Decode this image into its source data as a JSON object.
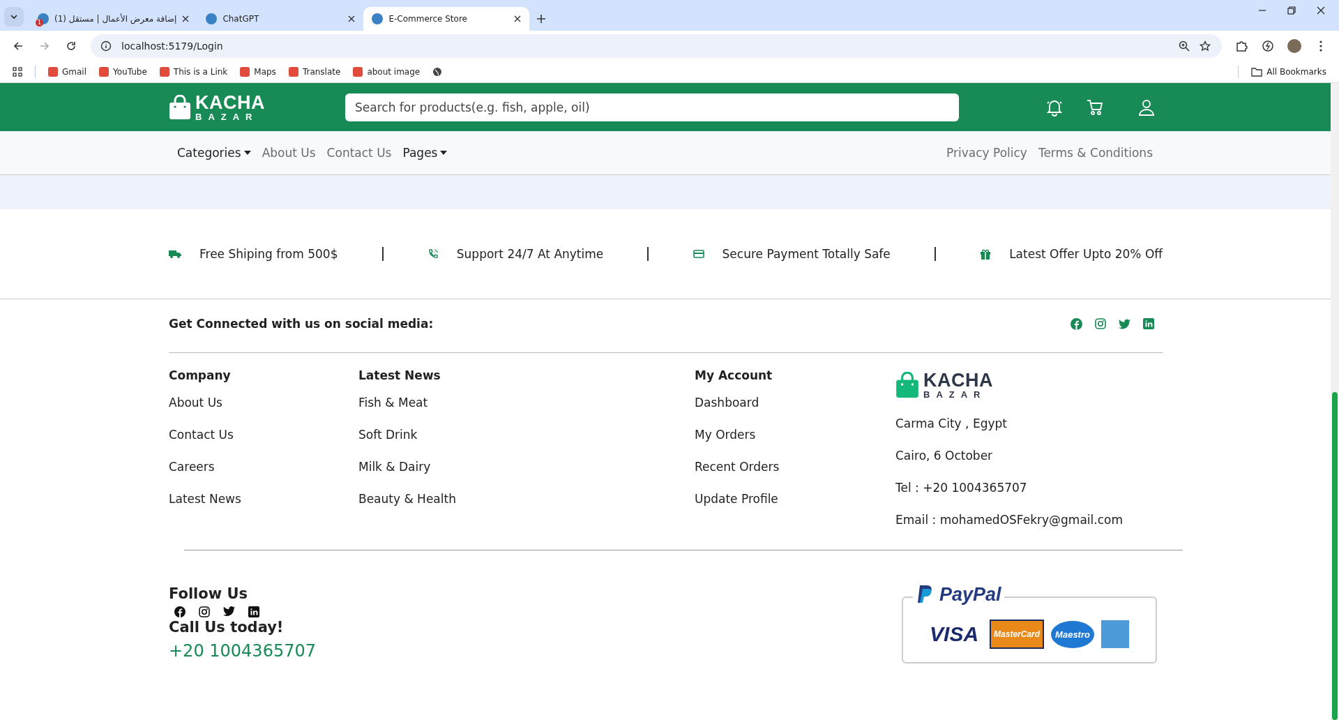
{
  "browser": {
    "tabs": [
      {
        "title": "(1) إضافة معرض الأعمال | مستقل",
        "badge": "1",
        "selected": false
      },
      {
        "title": "ChatGPT",
        "selected": false
      },
      {
        "title": "E-Commerce Store",
        "selected": true
      }
    ],
    "url": "localhost:5179/Login",
    "bookmarks": [
      "Gmail",
      "YouTube",
      "This is a Link",
      "Maps",
      "Translate",
      "about image"
    ],
    "all_bookmarks": "All Bookmarks"
  },
  "header": {
    "logo": {
      "top": "KACHA",
      "bottom": "BAZAR"
    },
    "search": {
      "placeholder": "Search for products(e.g. fish, apple, oil)"
    }
  },
  "nav": {
    "left": [
      {
        "label": "Categories",
        "dropdown": true
      },
      {
        "label": "About Us",
        "dropdown": false
      },
      {
        "label": "Contact Us",
        "dropdown": false
      },
      {
        "label": "Pages",
        "dropdown": true
      }
    ],
    "right": [
      "Privacy Policy",
      "Terms & Conditions"
    ]
  },
  "features": [
    {
      "kind": "truck",
      "text": "Free Shiping from 500$"
    },
    {
      "kind": "phone",
      "text": "Support 24/7 At Anytime"
    },
    {
      "kind": "card",
      "text": "Secure Payment Totally Safe"
    },
    {
      "kind": "gift",
      "text": "Latest Offer Upto 20% Off"
    }
  ],
  "social_bar": {
    "title": "Get Connected with us on social media:"
  },
  "footer_columns": [
    {
      "title": "Company",
      "links": [
        "About Us",
        "Contact Us",
        "Careers",
        "Latest News"
      ]
    },
    {
      "title": "Latest News",
      "links": [
        "Fish & Meat",
        "Soft Drink",
        "Milk & Dairy",
        "Beauty & Health"
      ]
    },
    {
      "title": "My Account",
      "links": [
        "Dashboard",
        "My Orders",
        "Recent Orders",
        "Update Profile"
      ]
    }
  ],
  "footer_contact": {
    "logo": {
      "top": "KACHA",
      "bottom": "BAZAR"
    },
    "lines": [
      "Carma City , Egypt",
      "Cairo, 6 October",
      "Tel : +20 1004365707",
      "Email : mohamedOSFekry@gmail.com"
    ]
  },
  "bottom": {
    "follow_title": "Follow Us",
    "call_title": "Call Us today!",
    "phone": "+20 1004365707",
    "payment": {
      "paypal": "PayPal",
      "cards": [
        "VISA",
        "MasterCard",
        "Maestro"
      ]
    }
  }
}
